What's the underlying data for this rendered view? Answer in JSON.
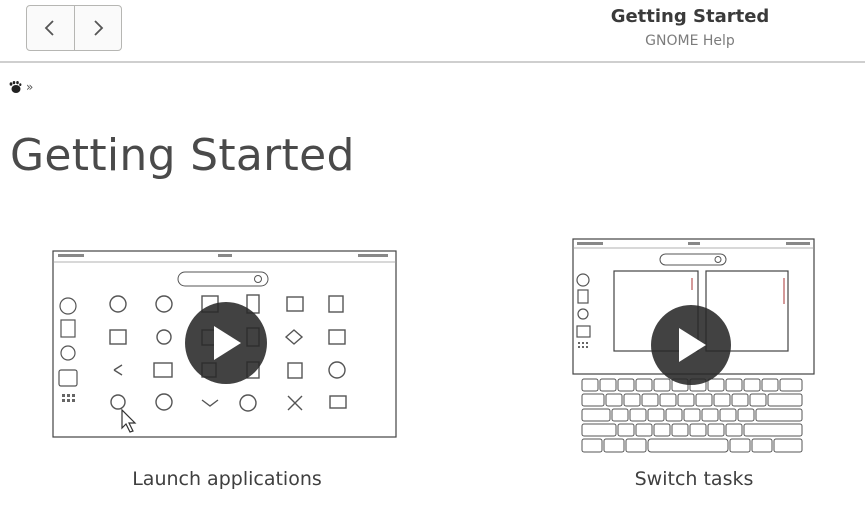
{
  "window": {
    "title": "Getting Started",
    "subtitle": "GNOME Help"
  },
  "nav": {
    "back_icon": "chevron-left-icon",
    "forward_icon": "chevron-right-icon"
  },
  "breadcrumb": {
    "home_icon": "gnome-foot-icon",
    "separator": "»"
  },
  "page": {
    "heading": "Getting Started"
  },
  "cards": [
    {
      "label": "Launch applications",
      "icon": "play-icon"
    },
    {
      "label": "Switch tasks",
      "icon": "play-icon"
    }
  ],
  "colors": {
    "play_overlay": "#282828",
    "header_border": "#cfcfcf",
    "text": "#3f3f3f"
  }
}
